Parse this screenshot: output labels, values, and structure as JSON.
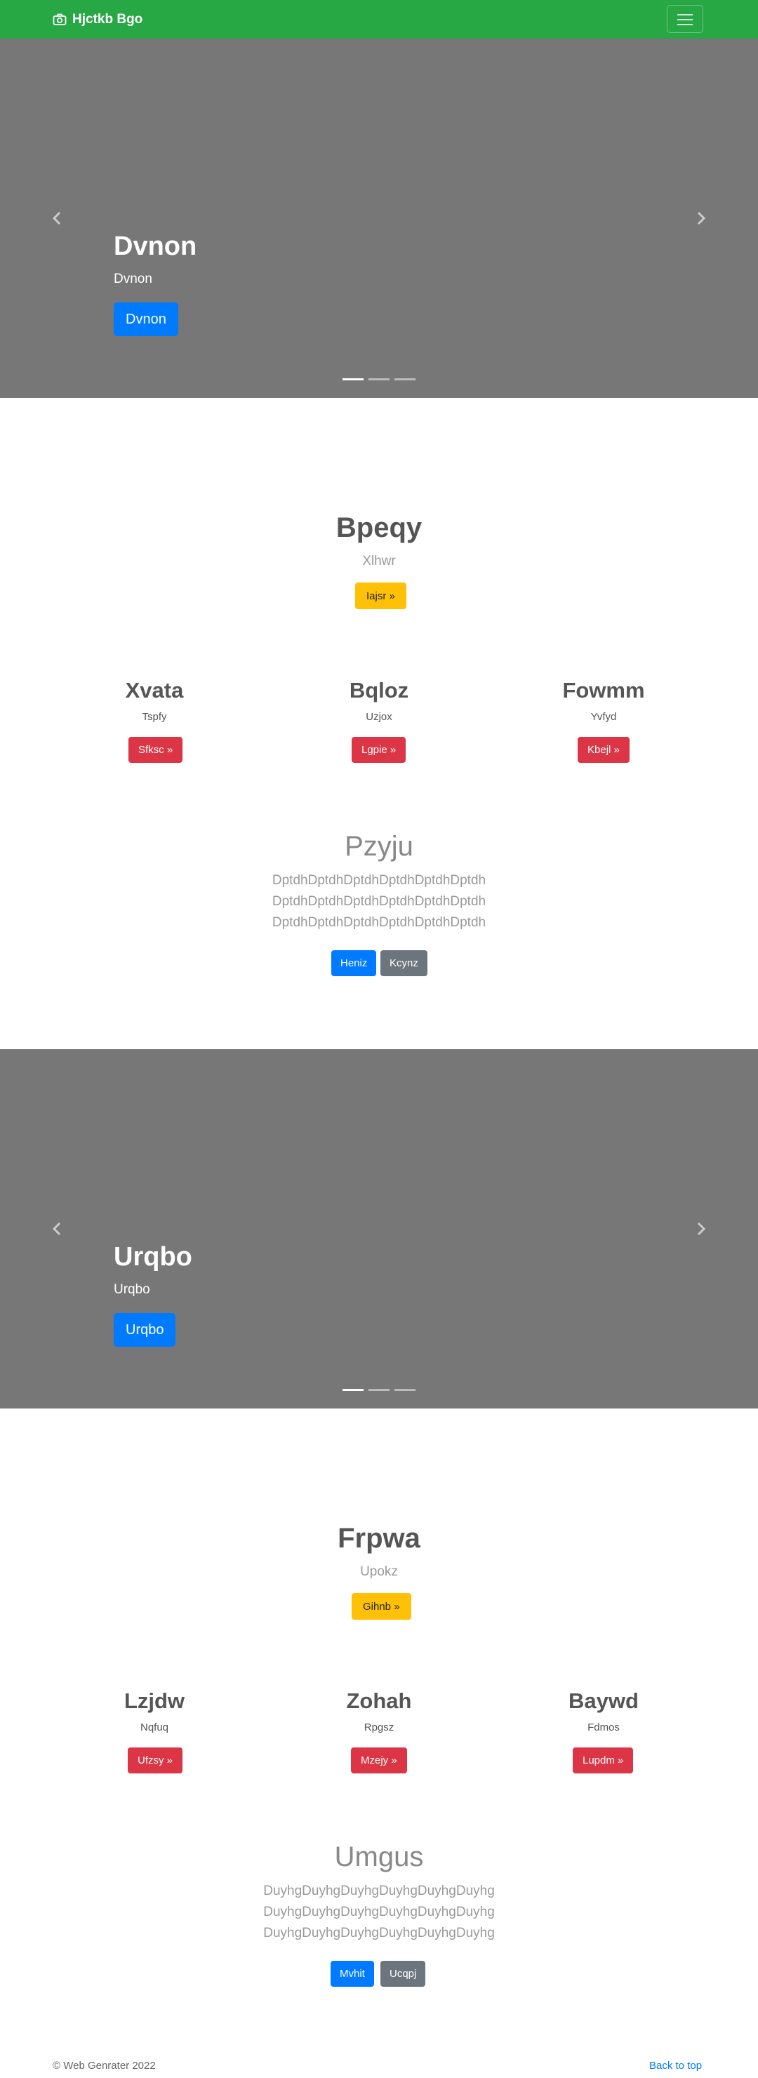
{
  "navbar": {
    "brand": "Hjctkb Bgo",
    "brand_icon": "camera-icon",
    "toggler_icon": "hamburger-icon",
    "bg_color": "#28a745"
  },
  "sections": [
    {
      "carousel": {
        "caption_title": "Dvnon",
        "caption_text": "Dvnon",
        "button_label": "Dvnon",
        "slides": 3,
        "active": 1
      },
      "hero": {
        "title": "Bpeqy",
        "subtitle": "Xlhwr",
        "button_label": "Iajsr »"
      },
      "columns": [
        {
          "title": "Xvata",
          "text": "Tspfy",
          "button_label": "Sfksc »"
        },
        {
          "title": "Bqloz",
          "text": "Uzjox",
          "button_label": "Lgpie »"
        },
        {
          "title": "Fowmm",
          "text": "Yvfyd",
          "button_label": "Kbejl »"
        }
      ],
      "feature": {
        "title": "Pzyju",
        "lines": [
          "DptdhDptdhDptdhDptdhDptdhDptdh",
          "DptdhDptdhDptdhDptdhDptdhDptdh",
          "DptdhDptdhDptdhDptdhDptdhDptdh"
        ],
        "primary_label": "Heniz",
        "secondary_label": "Kcynz"
      }
    },
    {
      "carousel": {
        "caption_title": "Urqbo",
        "caption_text": "Urqbo",
        "button_label": "Urqbo",
        "slides": 3,
        "active": 1
      },
      "hero": {
        "title": "Frpwa",
        "subtitle": "Upokz",
        "button_label": "Gihnb »"
      },
      "columns": [
        {
          "title": "Lzjdw",
          "text": "Nqfuq",
          "button_label": "Ufzsy »"
        },
        {
          "title": "Zohah",
          "text": "Rpgsz",
          "button_label": "Mzejy »"
        },
        {
          "title": "Baywd",
          "text": "Fdmos",
          "button_label": "Lupdm »"
        }
      ],
      "feature": {
        "title": "Umgus",
        "lines": [
          "DuyhgDuyhgDuyhgDuyhgDuyhgDuyhg",
          "DuyhgDuyhgDuyhgDuyhgDuyhgDuyhg",
          "DuyhgDuyhgDuyhgDuyhgDuyhgDuyhg"
        ],
        "primary_label": "Mvhit",
        "secondary_label": "Ucqpj"
      }
    }
  ],
  "footer": {
    "copyright": "© Web Genrater 2022",
    "back_to_top": "Back to top"
  }
}
